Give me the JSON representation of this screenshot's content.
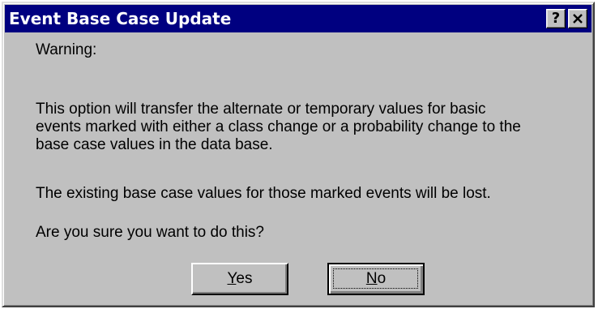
{
  "window": {
    "title": "Event Base Case Update",
    "help_label": "?"
  },
  "content": {
    "warning": "Warning:",
    "message_lines": [
      "This option will transfer the alternate or temporary values for basic",
      "events marked with either a class change or a probability change to the",
      "base case values in the data base."
    ],
    "consequence": "The existing base case values for those marked events will be lost.",
    "question": "Are you sure you want to do this?"
  },
  "buttons": {
    "yes": {
      "mnemonic": "Y",
      "rest": "es"
    },
    "no": {
      "mnemonic": "N",
      "rest": "o",
      "focused": true
    }
  },
  "colors": {
    "titlebar": "#000080",
    "face": "#c0c0c0",
    "title_text": "#ffffff"
  },
  "icons": {
    "help": "question-mark",
    "close": "x-cross"
  }
}
